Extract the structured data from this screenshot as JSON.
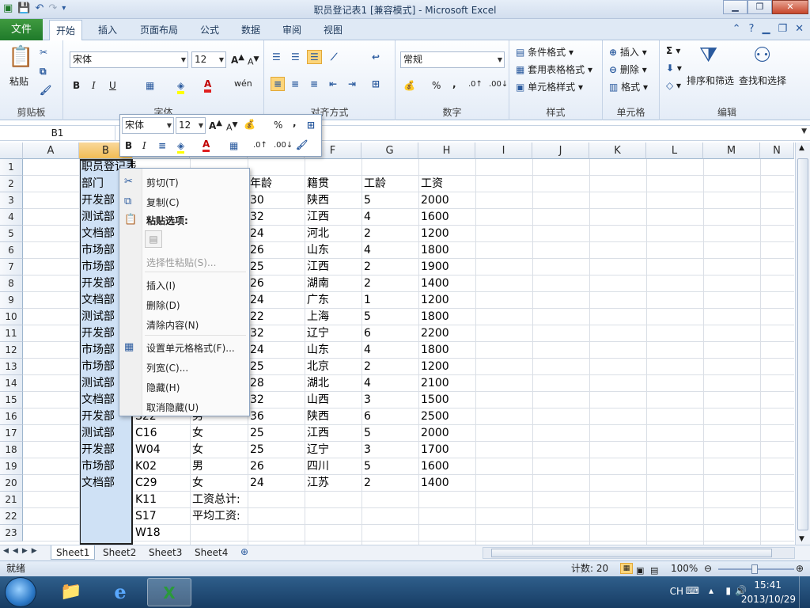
{
  "window": {
    "title": "职员登记表1 [兼容模式] - Microsoft Excel"
  },
  "ribbon_tabs": {
    "file": "文件",
    "items": [
      "开始",
      "插入",
      "页面布局",
      "公式",
      "数据",
      "审阅",
      "视图"
    ]
  },
  "ribbon": {
    "font_name": "宋体",
    "font_size": "12",
    "number_format": "常规",
    "groups": {
      "clipboard": "剪贴板",
      "font": "字体",
      "align": "对齐方式",
      "number": "数字",
      "styles": "样式",
      "cells": "单元格",
      "edit": "编辑"
    },
    "buttons": {
      "paste": "粘贴",
      "cond_format": "条件格式",
      "table_format": "套用表格格式",
      "cell_style": "单元格样式",
      "insert": "插入",
      "delete": "删除",
      "format": "格式",
      "sort_filter": "排序和筛选",
      "find_select": "查找和选择"
    }
  },
  "formula_bar": {
    "name_box": "B1"
  },
  "mini_toolbar": {
    "font_name": "宋体",
    "font_size": "12"
  },
  "columns": [
    "A",
    "B",
    "C",
    "D",
    "E",
    "F",
    "G",
    "H",
    "I",
    "J",
    "K",
    "L",
    "M",
    "N"
  ],
  "rows": [
    "1",
    "2",
    "3",
    "4",
    "5",
    "6",
    "7",
    "8",
    "9",
    "10",
    "11",
    "12",
    "13",
    "14",
    "15",
    "16",
    "17",
    "18",
    "19",
    "20",
    "21",
    "22",
    "23"
  ],
  "cells": {
    "b1": "职员登记表",
    "headers": {
      "dept": "部门",
      "age": "年龄",
      "origin": "籍贯",
      "years": "工龄",
      "salary": "工资"
    },
    "dept": [
      "开发部",
      "测试部",
      "文档部",
      "市场部",
      "市场部",
      "开发部",
      "文档部",
      "测试部",
      "开发部",
      "市场部",
      "市场部",
      "测试部",
      "文档部",
      "开发部",
      "测试部",
      "开发部",
      "市场部",
      "文档部"
    ],
    "age": [
      "30",
      "32",
      "24",
      "26",
      "25",
      "26",
      "24",
      "22",
      "32",
      "24",
      "25",
      "28",
      "32",
      "36",
      "25",
      "25",
      "26",
      "24"
    ],
    "origin": [
      "陕西",
      "江西",
      "河北",
      "山东",
      "江西",
      "湖南",
      "广东",
      "上海",
      "辽宁",
      "山东",
      "北京",
      "湖北",
      "山西",
      "陕西",
      "江西",
      "辽宁",
      "四川",
      "江苏"
    ],
    "years": [
      "5",
      "4",
      "2",
      "4",
      "2",
      "2",
      "1",
      "5",
      "6",
      "4",
      "2",
      "4",
      "3",
      "6",
      "5",
      "3",
      "5",
      "2"
    ],
    "salary": [
      "2000",
      "1600",
      "1200",
      "1800",
      "1900",
      "1400",
      "1200",
      "1800",
      "2200",
      "1800",
      "1200",
      "2100",
      "1500",
      "2500",
      "2000",
      "1700",
      "1600",
      "1400"
    ],
    "c_partial": {
      "r16": "S22",
      "r17": "C16",
      "r18": "W04",
      "r19": "K02",
      "r20": "C29",
      "r21": "K11",
      "r22": "S17",
      "r23": "W18"
    },
    "d_partial": {
      "r16": "男",
      "r17": "女",
      "r18": "女",
      "r19": "男",
      "r20": "女",
      "r21": "工资总计:",
      "r22": "平均工资:"
    }
  },
  "context_menu": {
    "cut": "剪切(T)",
    "copy": "复制(C)",
    "paste_options": "粘贴选项:",
    "paste_special": "选择性粘贴(S)...",
    "insert": "插入(I)",
    "delete": "删除(D)",
    "clear": "清除内容(N)",
    "format_cells": "设置单元格格式(F)...",
    "col_width": "列宽(C)...",
    "hide": "隐藏(H)",
    "unhide": "取消隐藏(U)"
  },
  "sheets": [
    "Sheet1",
    "Sheet2",
    "Sheet3",
    "Sheet4"
  ],
  "status": {
    "ready": "就绪",
    "count": "计数: 20",
    "zoom": "100%"
  },
  "taskbar": {
    "ime": "CH",
    "time": "15:41",
    "date": "2013/10/29"
  }
}
